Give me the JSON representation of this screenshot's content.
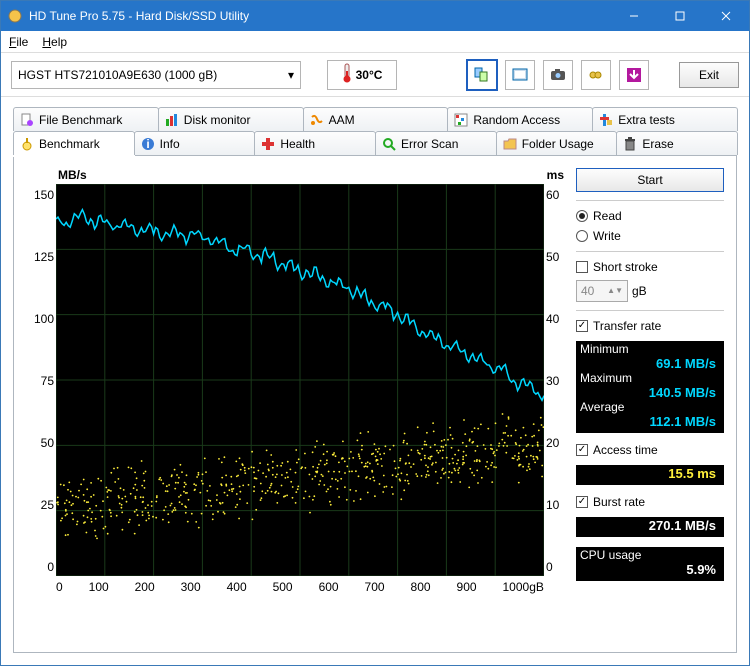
{
  "window": {
    "title": "HD Tune Pro 5.75 - Hard Disk/SSD Utility"
  },
  "menu": {
    "file": "File",
    "help": "Help"
  },
  "toolbar": {
    "drive": "HGST HTS721010A9E630 (1000 gB)",
    "temp": "30°C",
    "exit": "Exit"
  },
  "tabs_row1": [
    {
      "label": "File Benchmark",
      "icon": "file-benchmark-icon"
    },
    {
      "label": "Disk monitor",
      "icon": "disk-monitor-icon"
    },
    {
      "label": "AAM",
      "icon": "aam-icon"
    },
    {
      "label": "Random Access",
      "icon": "random-access-icon"
    },
    {
      "label": "Extra tests",
      "icon": "extra-tests-icon"
    }
  ],
  "tabs_row2": [
    {
      "label": "Benchmark",
      "icon": "benchmark-icon",
      "active": true
    },
    {
      "label": "Info",
      "icon": "info-icon"
    },
    {
      "label": "Health",
      "icon": "health-icon"
    },
    {
      "label": "Error Scan",
      "icon": "error-scan-icon"
    },
    {
      "label": "Folder Usage",
      "icon": "folder-usage-icon"
    },
    {
      "label": "Erase",
      "icon": "erase-icon"
    }
  ],
  "side": {
    "start": "Start",
    "read": "Read",
    "write": "Write",
    "short_stroke": "Short stroke",
    "short_stroke_val": "40",
    "short_stroke_unit": "gB",
    "transfer_rate": "Transfer rate",
    "minimum_label": "Minimum",
    "minimum_val": "69.1 MB/s",
    "maximum_label": "Maximum",
    "maximum_val": "140.5 MB/s",
    "average_label": "Average",
    "average_val": "112.1 MB/s",
    "access_time": "Access time",
    "access_time_val": "15.5 ms",
    "burst_rate": "Burst rate",
    "burst_rate_val": "270.1 MB/s",
    "cpu_usage": "CPU usage",
    "cpu_usage_val": "5.9%"
  },
  "chart_header": {
    "left": "MB/s",
    "right": "ms"
  },
  "chart_data": {
    "type": "line+scatter",
    "title": "Transfer rate and access time vs. position",
    "xlabel": "gB",
    "x_range": [
      0,
      1000
    ],
    "x_ticks": [
      0,
      100,
      200,
      300,
      400,
      500,
      600,
      700,
      800,
      900,
      "1000gB"
    ],
    "y_left_label": "MB/s",
    "y_left_range": [
      0,
      150
    ],
    "y_left_ticks": [
      150,
      125,
      100,
      75,
      50,
      25,
      0
    ],
    "y_right_label": "ms",
    "y_right_range": [
      0,
      60
    ],
    "y_right_ticks": [
      60,
      50,
      40,
      30,
      20,
      10,
      0
    ],
    "series": [
      {
        "name": "Transfer rate",
        "axis": "left",
        "color": "#00d7ff",
        "type": "line",
        "x": [
          0,
          50,
          100,
          150,
          200,
          250,
          300,
          350,
          400,
          450,
          500,
          550,
          600,
          650,
          700,
          750,
          800,
          850,
          900,
          950,
          1000
        ],
        "y": [
          135,
          137,
          135,
          134,
          132,
          131,
          130,
          126,
          124,
          121,
          117,
          114,
          110,
          105,
          100,
          94,
          89,
          84,
          80,
          74,
          69
        ]
      },
      {
        "name": "Access time",
        "axis": "right",
        "color": "#ffef3b",
        "type": "scatter",
        "note": "approximate cloud of ~600 points between 6 and 28 ms trending upward; rendered procedurally",
        "trend": {
          "x": [
            0,
            1000
          ],
          "y": [
            10,
            20
          ]
        },
        "spread_ms": 8
      }
    ]
  }
}
